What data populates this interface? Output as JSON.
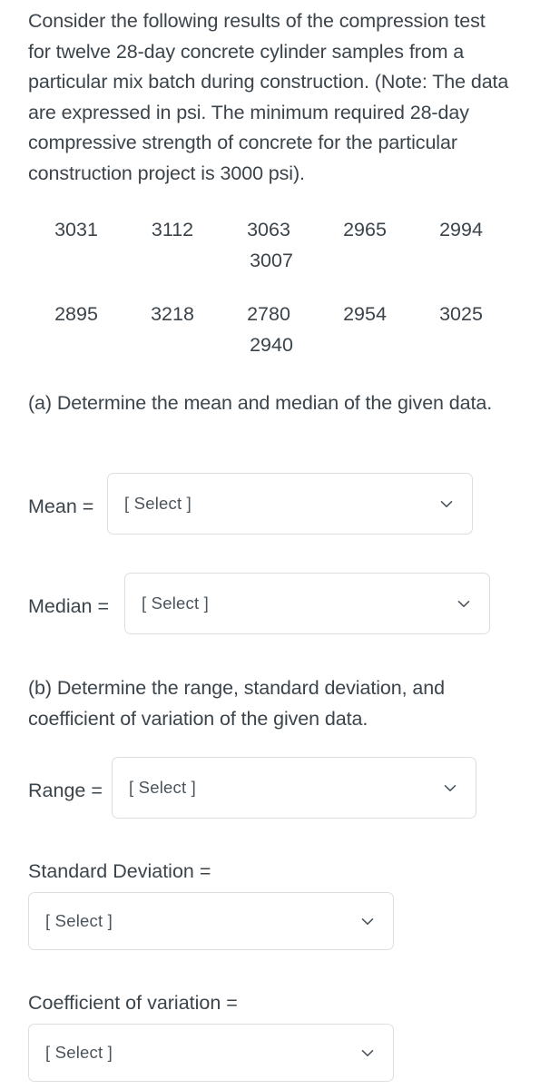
{
  "prompt": {
    "text": "Consider the following results of the compression test for twelve 28-day concrete cylinder samples from a particular mix batch during construction. (Note: The data are expressed in psi. The minimum required 28-day compressive strength of concrete for the particular construction project is 3000 psi)."
  },
  "data": {
    "row1": [
      "3031",
      "3112",
      "3063",
      "2965",
      "2994"
    ],
    "row1_tail": [
      "3007"
    ],
    "row2": [
      "2895",
      "3218",
      "2780",
      "2954",
      "3025"
    ],
    "row2_tail": [
      "2940"
    ]
  },
  "questions": {
    "a": "(a) Determine the mean and median of the given data.",
    "b": "(b) Determine the range, standard deviation, and coefficient of variation of the given data."
  },
  "fields": {
    "mean": {
      "label": "Mean =",
      "value": "[ Select ]"
    },
    "median": {
      "label": "Median =",
      "value": "[ Select ]"
    },
    "range": {
      "label": "Range =",
      "value": "[ Select ]"
    },
    "standard_deviation": {
      "label": "Standard Deviation =",
      "value": "[ Select ]"
    },
    "coefficient_of_variation": {
      "label": "Coefficient of variation =",
      "value": "[ Select ]"
    }
  },
  "icons": {
    "dropdown": "chevron-down-icon"
  },
  "colors": {
    "text": "#3c444b",
    "field_border": "#dcdfe2",
    "field_background": "#ffffff",
    "chevron": "#4b545c"
  }
}
